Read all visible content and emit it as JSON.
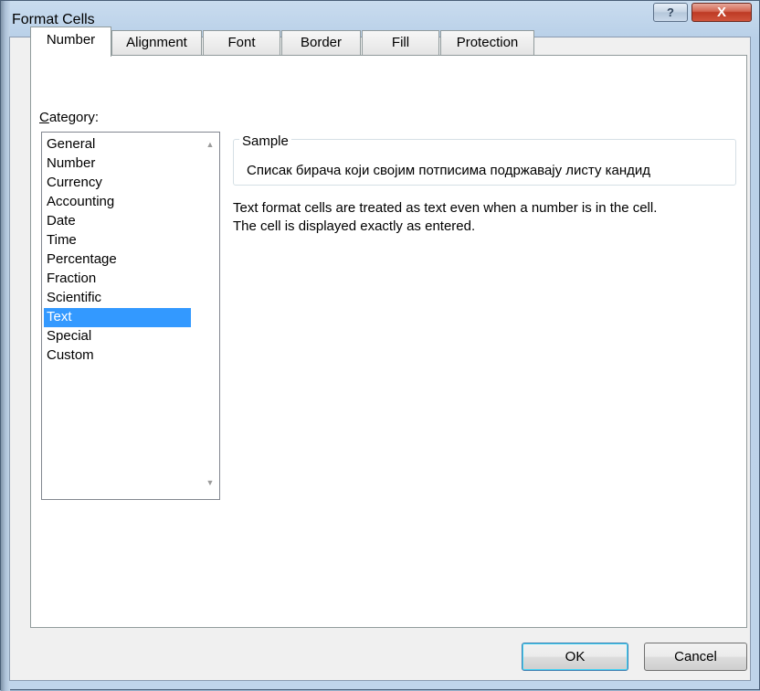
{
  "window": {
    "title": "Format Cells",
    "help_glyph": "?",
    "close_glyph": "X"
  },
  "tabs": [
    {
      "label": "Number",
      "active": true
    },
    {
      "label": "Alignment",
      "active": false
    },
    {
      "label": "Font",
      "active": false
    },
    {
      "label": "Border",
      "active": false
    },
    {
      "label": "Fill",
      "active": false
    },
    {
      "label": "Protection",
      "active": false
    }
  ],
  "category": {
    "label_underlined": "C",
    "label_rest": "ategory:",
    "items": [
      "General",
      "Number",
      "Currency",
      "Accounting",
      "Date",
      "Time",
      "Percentage",
      "Fraction",
      "Scientific",
      "Text",
      "Special",
      "Custom"
    ],
    "selected": "Text"
  },
  "sample": {
    "legend": "Sample",
    "value": "Списак бирача који својим потписима подржавају листу кандид"
  },
  "description": {
    "line1": "Text format cells are treated as text even when a number is in the cell.",
    "line2": "The cell is displayed exactly as entered."
  },
  "buttons": {
    "ok": "OK",
    "cancel": "Cancel"
  },
  "colors": {
    "selection": "#3399ff",
    "close_button": "#c94a32"
  }
}
